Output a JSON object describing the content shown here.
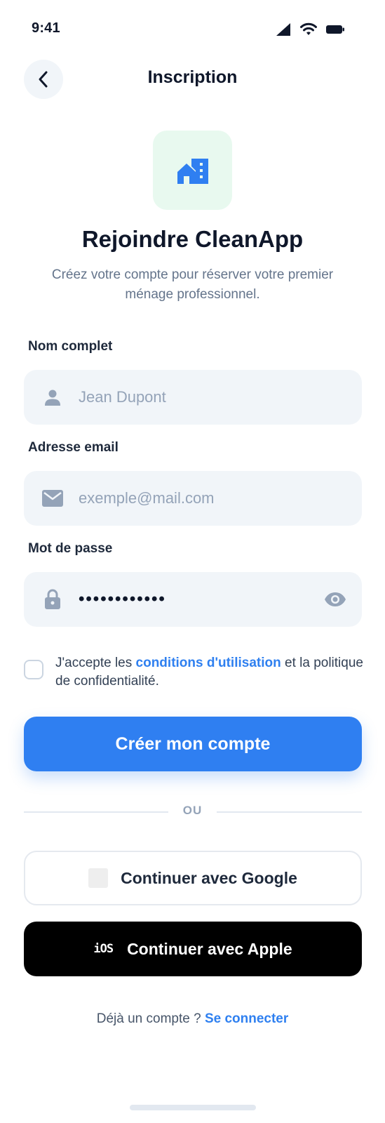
{
  "status_bar": {
    "time": "9:41"
  },
  "header": {
    "title": "Inscription"
  },
  "hero": {
    "title": "Rejoindre CleanApp",
    "subtitle": "Créez votre compte pour réserver votre premier ménage professionnel."
  },
  "form": {
    "name": {
      "label": "Nom complet",
      "placeholder": "Jean Dupont",
      "icon": "user-icon"
    },
    "email": {
      "label": "Adresse email",
      "placeholder": "exemple@mail.com",
      "icon": "mail-icon"
    },
    "password": {
      "label": "Mot de passe",
      "value": "••••••••••••",
      "icon": "lock-icon",
      "toggle_icon": "eye-icon"
    }
  },
  "terms": {
    "prefix": "J'accepte les ",
    "link": "conditions d'utilisation",
    "suffix": " et la politique de confidentialité.",
    "checked": false
  },
  "actions": {
    "submit": "Créer mon compte",
    "divider": "OU",
    "google": "Continuer avec Google",
    "apple": "Continuer avec Apple",
    "apple_icon_label": "iOS"
  },
  "footer": {
    "prompt": "Déjà un compte ? ",
    "link": "Se connecter"
  },
  "colors": {
    "primary": "#2f7ff1",
    "logo_bg": "#e8f9ef",
    "field_bg": "#f1f5f9",
    "link": "#2f80f0"
  }
}
